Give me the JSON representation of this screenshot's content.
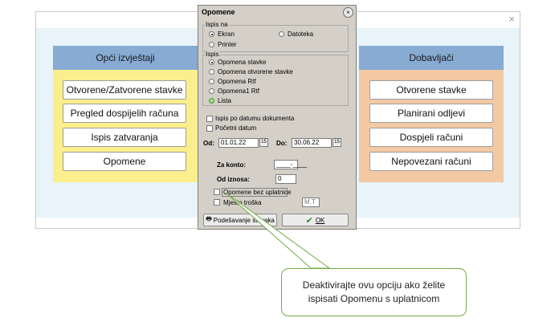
{
  "left_panel": {
    "title": "Opći izvještaji",
    "buttons": [
      "Otvorene/Zatvorene stavke",
      "Pregled dospijelih računa",
      "Ispis zatvaranja",
      "Opomene"
    ]
  },
  "right_panel": {
    "title": "Dobavljači",
    "buttons": [
      "Otvorene stavke",
      "Planirani odljevi",
      "Dospjeli računi",
      "Nepovezani računi"
    ]
  },
  "background_window": {
    "close_glyph": "×"
  },
  "dialog": {
    "title": "Opomene",
    "close_glyph": "×",
    "ispis_na": {
      "title": "Ispis na",
      "options": [
        "Ekran",
        "Datoteka",
        "Printer"
      ],
      "selected": "Ekran"
    },
    "ispis": {
      "title": "Ispis",
      "options": [
        "Opomena stavke",
        "Opomena otvorene stavke",
        "Opomena Rtf",
        "Opomena1 Rtf",
        "Lista"
      ],
      "selected": "Opomena stavke"
    },
    "checkbox_ispis_po_datumu": "Ispis po datumu dokumenta",
    "checkbox_pocetni_datum": "Početni datum",
    "od_label": "Od:",
    "od_value": "01.01.22",
    "do_label": "Do:",
    "do_value": "30.06.22",
    "cal_glyph": "15",
    "za_konto_label": "Za konto:",
    "za_konto_value": "____-____",
    "od_iznosa_label": "Od iznosa:",
    "od_iznosa_value": "0",
    "checkbox_opomene_bez_uplatnice": "Opomene bez uplatnice",
    "checkbox_mjesto_troska": "Mjesto troška",
    "mjesto_troska_value": "M.T",
    "podesavanje_label": "Podešavanje stavaka",
    "ok_label": "OK",
    "ok_glyph": "✔",
    "printer_glyph": "🖶"
  },
  "callout": {
    "line1": "Deaktivirajte ovu opciju ako želite",
    "line2": "ispisati Opomenu s uplatnicom"
  },
  "colors": {
    "panel_header": "#87abd3",
    "left_body": "#fbef8d",
    "right_body": "#f3c9a4",
    "callout_border": "#70ad47"
  }
}
